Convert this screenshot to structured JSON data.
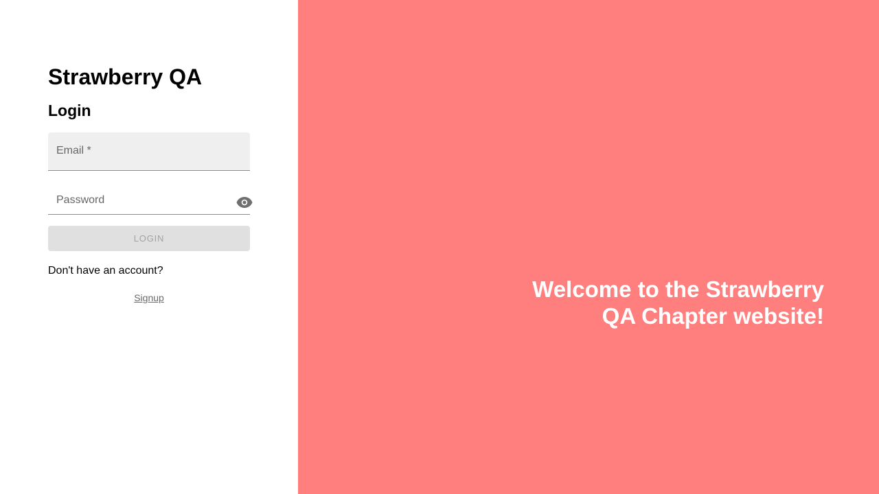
{
  "app": {
    "title": "Strawberry QA"
  },
  "login": {
    "heading": "Login",
    "email_label": "Email *",
    "email_value": "",
    "password_label": "Password",
    "password_value": "",
    "password_toggle_icon": "eye-icon",
    "button_label": "LOGIN",
    "no_account_text": "Don't have an account?",
    "signup_link": "Signup"
  },
  "hero": {
    "welcome_text": "Welcome to the Strawberry QA Chapter website!"
  },
  "colors": {
    "hero_background": "#ff7e7e",
    "button_disabled": "#e0e0e0",
    "field_background": "#efefef"
  }
}
